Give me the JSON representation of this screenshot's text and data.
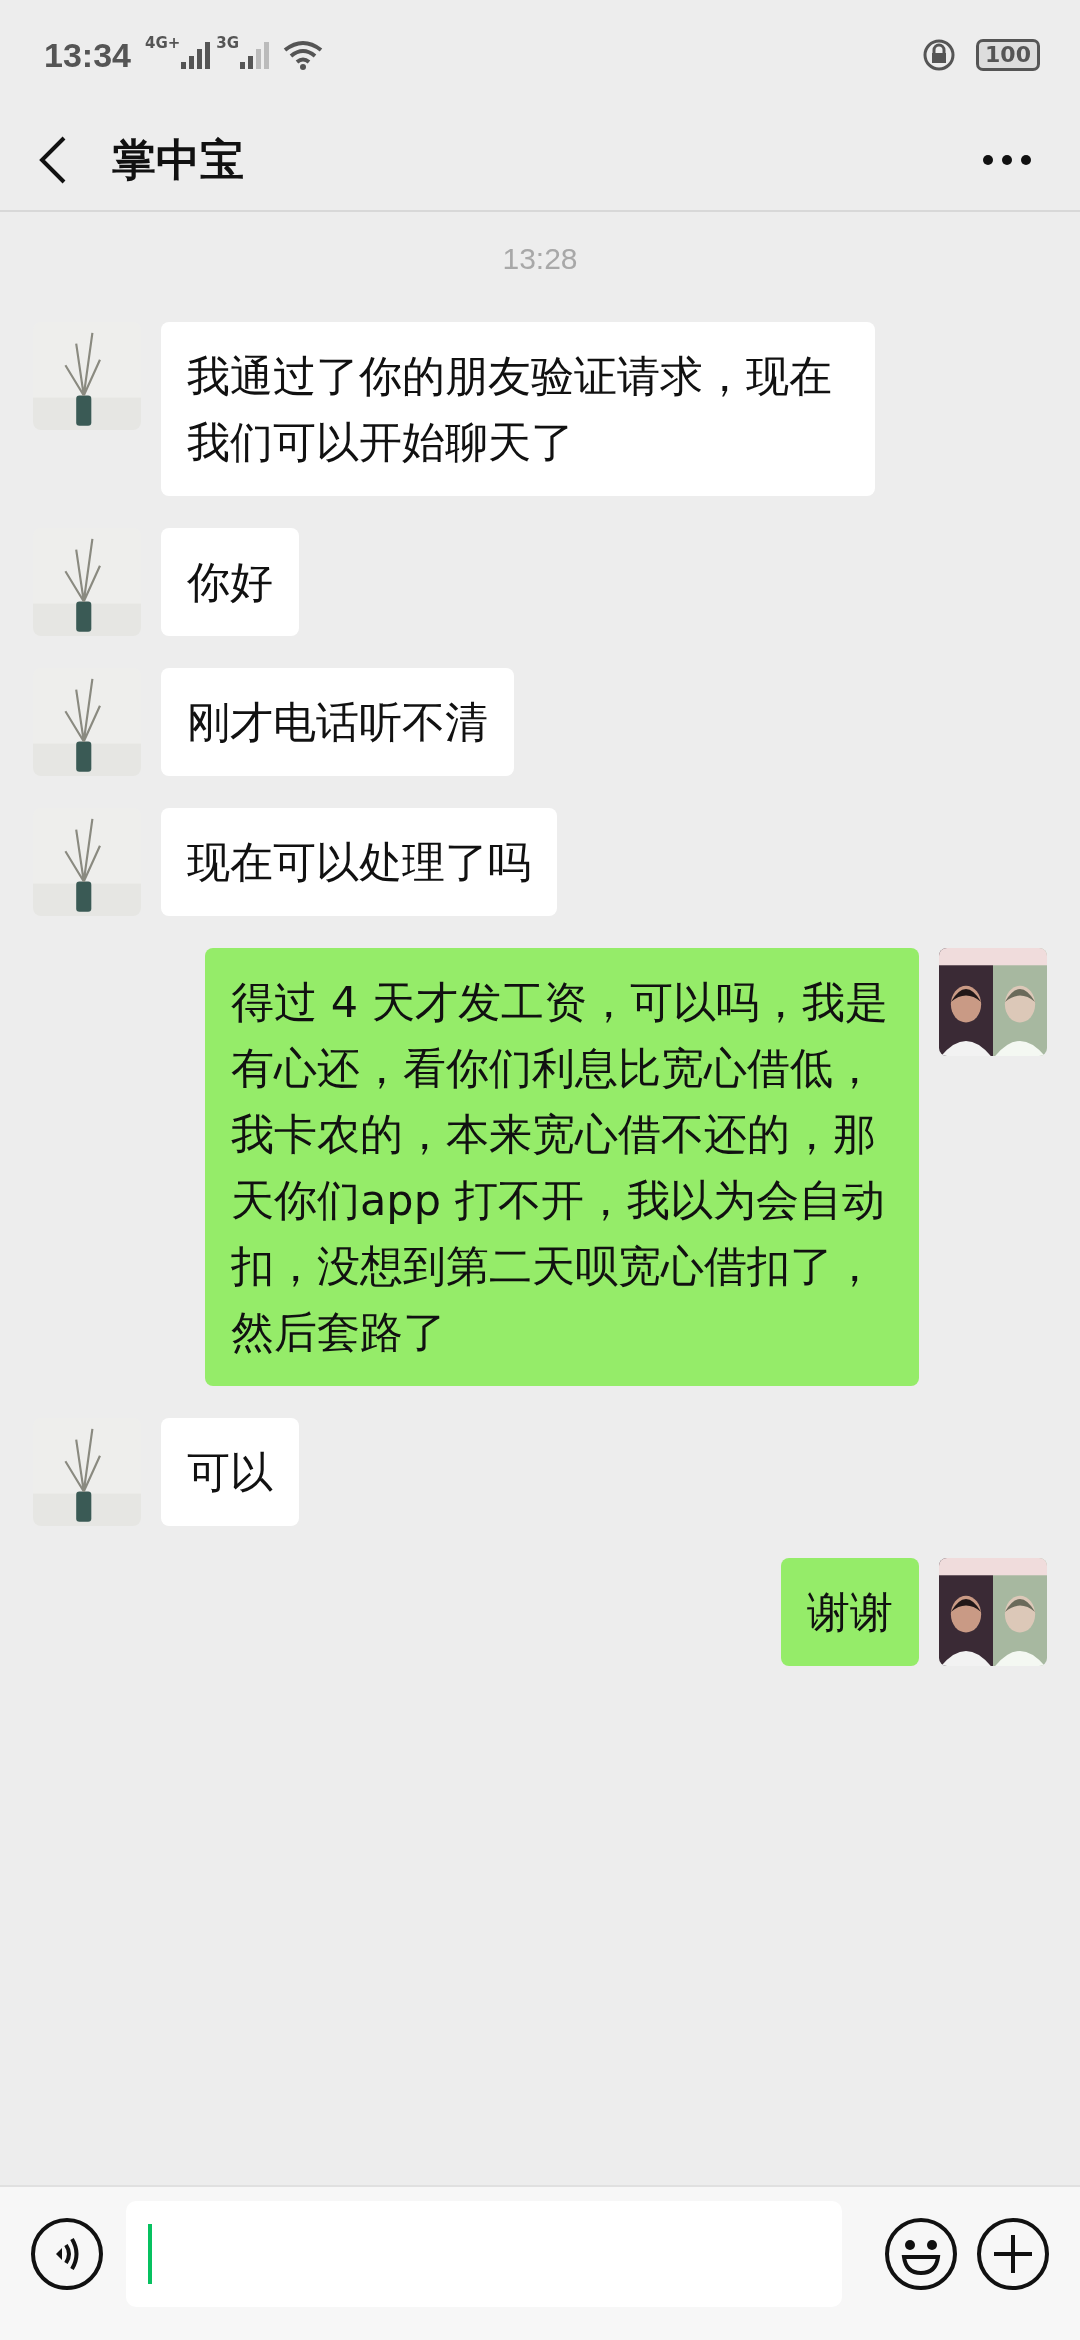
{
  "status_bar": {
    "time": "13:34",
    "sim1": "4G+",
    "sim2": "3G",
    "battery": "100"
  },
  "header": {
    "title": "掌中宝"
  },
  "messages": [
    {
      "kind": "time",
      "text": "13:28"
    },
    {
      "kind": "received",
      "text": "我通过了你的朋友验证请求，现在我们可以开始聊天了"
    },
    {
      "kind": "received",
      "text": "你好"
    },
    {
      "kind": "received",
      "text": "刚才电话听不清"
    },
    {
      "kind": "received",
      "text": "现在可以处理了吗"
    },
    {
      "kind": "sent",
      "text": "得过 4 天才发工资，可以吗，我是有心还，看你们利息比宽心借低，我卡农的，本来宽心借不还的，那天你们app 打不开，我以为会自动扣，没想到第二天呗宽心借扣了，然后套路了"
    },
    {
      "kind": "received",
      "text": "可以"
    },
    {
      "kind": "sent",
      "text": "谢谢"
    }
  ]
}
